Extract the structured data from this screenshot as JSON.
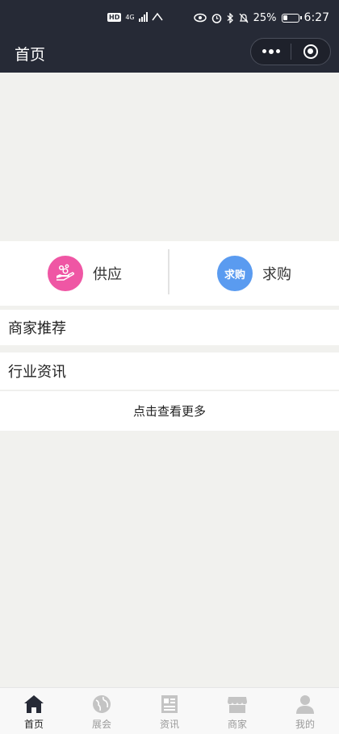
{
  "status_bar": {
    "hd_badge": "HD",
    "network": "4G",
    "battery_percent": "25%",
    "time": "6:27"
  },
  "nav": {
    "title": "首页"
  },
  "quick_actions": [
    {
      "label": "供应",
      "icon": "supply-hand-icon",
      "color": "#ef56a4"
    },
    {
      "label": "求购",
      "icon_text": "求购",
      "color": "#5a9bf0"
    }
  ],
  "sections": {
    "merchant_title": "商家推荐",
    "news_title": "行业资讯",
    "more_label": "点击查看更多"
  },
  "tabbar": {
    "items": [
      {
        "label": "首页",
        "icon": "home-icon",
        "active": true
      },
      {
        "label": "展会",
        "icon": "globe-icon",
        "active": false
      },
      {
        "label": "资讯",
        "icon": "newspaper-icon",
        "active": false
      },
      {
        "label": "商家",
        "icon": "store-icon",
        "active": false
      },
      {
        "label": "我的",
        "icon": "user-icon",
        "active": false
      }
    ]
  },
  "colors": {
    "nav_bg": "#262a36",
    "page_bg": "#f1f1ee",
    "supply_pink": "#ef56a4",
    "demand_blue": "#5a9bf0"
  }
}
